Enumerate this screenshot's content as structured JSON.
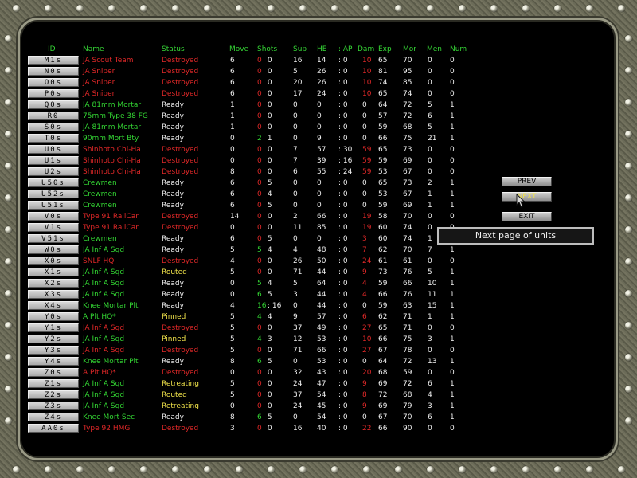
{
  "headers": {
    "id": "ID",
    "name": "Name",
    "status": "Status",
    "move": "Move",
    "shots": "Shots",
    "sup": "Sup",
    "he": "HE",
    "ap": ": AP",
    "dam": "Dam",
    "exp": "Exp",
    "mor": "Mor",
    "men": "Men",
    "num": "Num"
  },
  "colors": {
    "green": "#33d633",
    "red": "#e02828",
    "yellow": "#f0e24a"
  },
  "units": [
    {
      "id": "M1s",
      "name": "JA Scout Team",
      "status": "Destroyed",
      "move": "6",
      "shots_a": "0",
      "shots_b": ": 0",
      "sup": "16",
      "he": "14",
      "ap": ": 0",
      "dam": "10",
      "exp": "65",
      "mor": "70",
      "men": "0",
      "num": "0"
    },
    {
      "id": "N0s",
      "name": "JA Sniper",
      "status": "Destroyed",
      "move": "6",
      "shots_a": "0",
      "shots_b": ": 0",
      "sup": "5",
      "he": "26",
      "ap": ": 0",
      "dam": "10",
      "exp": "81",
      "mor": "95",
      "men": "0",
      "num": "0"
    },
    {
      "id": "O0s",
      "name": "JA Sniper",
      "status": "Destroyed",
      "move": "6",
      "shots_a": "0",
      "shots_b": ": 0",
      "sup": "20",
      "he": "26",
      "ap": ": 0",
      "dam": "10",
      "exp": "74",
      "mor": "85",
      "men": "0",
      "num": "0"
    },
    {
      "id": "P0s",
      "name": "JA Sniper",
      "status": "Destroyed",
      "move": "6",
      "shots_a": "0",
      "shots_b": ": 0",
      "sup": "17",
      "he": "24",
      "ap": ": 0",
      "dam": "10",
      "exp": "65",
      "mor": "74",
      "men": "0",
      "num": "0"
    },
    {
      "id": "Q0s",
      "name": "JA 81mm Mortar",
      "status": "Ready",
      "move": "1",
      "shots_a": "0",
      "shots_b": ": 0",
      "sup": "0",
      "he": "0",
      "ap": ": 0",
      "dam": "0",
      "exp": "64",
      "mor": "72",
      "men": "5",
      "num": "1"
    },
    {
      "id": "R0",
      "name": "75mm Type 38 FG",
      "status": "Ready",
      "move": "1",
      "shots_a": "0",
      "shots_b": ": 0",
      "sup": "0",
      "he": "0",
      "ap": ": 0",
      "dam": "0",
      "exp": "57",
      "mor": "72",
      "men": "6",
      "num": "1"
    },
    {
      "id": "S0s",
      "name": "JA 81mm Mortar",
      "status": "Ready",
      "move": "1",
      "shots_a": "0",
      "shots_b": ": 0",
      "sup": "0",
      "he": "0",
      "ap": ": 0",
      "dam": "0",
      "exp": "59",
      "mor": "68",
      "men": "5",
      "num": "1"
    },
    {
      "id": "T0s",
      "name": "90mm Mort Bty",
      "status": "Ready",
      "move": "0",
      "shots_a": "2",
      "shots_b": ": 1",
      "sup": "0",
      "he": "9",
      "ap": ": 0",
      "dam": "0",
      "exp": "66",
      "mor": "75",
      "men": "21",
      "num": "1"
    },
    {
      "id": "U0s",
      "name": "Shinhoto Chi-Ha",
      "status": "Destroyed",
      "move": "0",
      "shots_a": "0",
      "shots_b": ": 0",
      "sup": "7",
      "he": "57",
      "ap": ": 30",
      "dam": "59",
      "exp": "65",
      "mor": "73",
      "men": "0",
      "num": "0"
    },
    {
      "id": "U1s",
      "name": "Shinhoto Chi-Ha",
      "status": "Destroyed",
      "move": "0",
      "shots_a": "0",
      "shots_b": ": 0",
      "sup": "7",
      "he": "39",
      "ap": ": 16",
      "dam": "59",
      "exp": "59",
      "mor": "69",
      "men": "0",
      "num": "0"
    },
    {
      "id": "U2s",
      "name": "Shinhoto Chi-Ha",
      "status": "Destroyed",
      "move": "8",
      "shots_a": "0",
      "shots_b": ": 0",
      "sup": "6",
      "he": "55",
      "ap": ": 24",
      "dam": "59",
      "exp": "53",
      "mor": "67",
      "men": "0",
      "num": "0"
    },
    {
      "id": "U50s",
      "name": "Crewmen",
      "status": "Ready",
      "move": "6",
      "shots_a": "0",
      "shots_b": ": 5",
      "sup": "0",
      "he": "0",
      "ap": ": 0",
      "dam": "0",
      "exp": "65",
      "mor": "73",
      "men": "2",
      "num": "1"
    },
    {
      "id": "U52s",
      "name": "Crewmen",
      "status": "Ready",
      "move": "6",
      "shots_a": "0",
      "shots_b": ": 4",
      "sup": "0",
      "he": "0",
      "ap": ": 0",
      "dam": "0",
      "exp": "53",
      "mor": "67",
      "men": "1",
      "num": "1"
    },
    {
      "id": "U51s",
      "name": "Crewmen",
      "status": "Ready",
      "move": "6",
      "shots_a": "0",
      "shots_b": ": 5",
      "sup": "0",
      "he": "0",
      "ap": ": 0",
      "dam": "0",
      "exp": "59",
      "mor": "69",
      "men": "1",
      "num": "1"
    },
    {
      "id": "V0s",
      "name": "Type 91 RailCar",
      "status": "Destroyed",
      "move": "14",
      "shots_a": "0",
      "shots_b": ": 0",
      "sup": "2",
      "he": "66",
      "ap": ": 0",
      "dam": "19",
      "exp": "58",
      "mor": "70",
      "men": "0",
      "num": "0"
    },
    {
      "id": "V1s",
      "name": "Type 91 RailCar",
      "status": "Destroyed",
      "move": "0",
      "shots_a": "0",
      "shots_b": ": 0",
      "sup": "11",
      "he": "85",
      "ap": ": 0",
      "dam": "19",
      "exp": "60",
      "mor": "74",
      "men": "0",
      "num": "0"
    },
    {
      "id": "V51s",
      "name": "Crewmen",
      "status": "Ready",
      "move": "6",
      "shots_a": "0",
      "shots_b": ": 5",
      "sup": "0",
      "he": "0",
      "ap": ": 0",
      "dam": "3",
      "exp": "60",
      "mor": "74",
      "men": "1",
      "num": "1"
    },
    {
      "id": "W0s",
      "name": "JA Inf A Sqd",
      "status": "Ready",
      "move": "5",
      "shots_a": "5",
      "shots_b": ": 4",
      "sup": "4",
      "he": "48",
      "ap": ": 0",
      "dam": "7",
      "exp": "62",
      "mor": "70",
      "men": "7",
      "num": "1"
    },
    {
      "id": "X0s",
      "name": "SNLF HQ",
      "status": "Destroyed",
      "move": "4",
      "shots_a": "0",
      "shots_b": ": 0",
      "sup": "26",
      "he": "50",
      "ap": ": 0",
      "dam": "24",
      "exp": "61",
      "mor": "61",
      "men": "0",
      "num": "0"
    },
    {
      "id": "X1s",
      "name": "JA Inf A Sqd",
      "status": "Routed",
      "move": "5",
      "shots_a": "0",
      "shots_b": ": 0",
      "sup": "71",
      "he": "44",
      "ap": ": 0",
      "dam": "9",
      "exp": "73",
      "mor": "76",
      "men": "5",
      "num": "1"
    },
    {
      "id": "X2s",
      "name": "JA Inf A Sqd",
      "status": "Ready",
      "move": "0",
      "shots_a": "5",
      "shots_b": ": 4",
      "sup": "5",
      "he": "64",
      "ap": ": 0",
      "dam": "4",
      "exp": "59",
      "mor": "66",
      "men": "10",
      "num": "1"
    },
    {
      "id": "X3s",
      "name": "JA Inf A Sqd",
      "status": "Ready",
      "move": "0",
      "shots_a": "6",
      "shots_b": ": 5",
      "sup": "3",
      "he": "44",
      "ap": ": 0",
      "dam": "4",
      "exp": "66",
      "mor": "76",
      "men": "11",
      "num": "1"
    },
    {
      "id": "X4s",
      "name": "Knee Mortar Plt",
      "status": "Ready",
      "move": "4",
      "shots_a": "16",
      "shots_b": ": 16",
      "sup": "0",
      "he": "44",
      "ap": ": 0",
      "dam": "0",
      "exp": "59",
      "mor": "63",
      "men": "15",
      "num": "1"
    },
    {
      "id": "Y0s",
      "name": "A Plt HQ*",
      "status": "Pinned",
      "move": "5",
      "shots_a": "4",
      "shots_b": ": 4",
      "sup": "9",
      "he": "57",
      "ap": ": 0",
      "dam": "6",
      "exp": "62",
      "mor": "71",
      "men": "1",
      "num": "1"
    },
    {
      "id": "Y1s",
      "name": "JA Inf A Sqd",
      "status": "Destroyed",
      "move": "5",
      "shots_a": "0",
      "shots_b": ": 0",
      "sup": "37",
      "he": "49",
      "ap": ": 0",
      "dam": "27",
      "exp": "65",
      "mor": "71",
      "men": "0",
      "num": "0"
    },
    {
      "id": "Y2s",
      "name": "JA Inf A Sqd",
      "status": "Pinned",
      "move": "5",
      "shots_a": "4",
      "shots_b": ": 3",
      "sup": "12",
      "he": "53",
      "ap": ": 0",
      "dam": "10",
      "exp": "66",
      "mor": "75",
      "men": "3",
      "num": "1"
    },
    {
      "id": "Y3s",
      "name": "JA Inf A Sqd",
      "status": "Destroyed",
      "move": "5",
      "shots_a": "0",
      "shots_b": ": 0",
      "sup": "71",
      "he": "66",
      "ap": ": 0",
      "dam": "27",
      "exp": "67",
      "mor": "78",
      "men": "0",
      "num": "0"
    },
    {
      "id": "Y4s",
      "name": "Knee Mortar Plt",
      "status": "Ready",
      "move": "8",
      "shots_a": "6",
      "shots_b": ": 5",
      "sup": "0",
      "he": "53",
      "ap": ": 0",
      "dam": "0",
      "exp": "64",
      "mor": "72",
      "men": "13",
      "num": "1"
    },
    {
      "id": "Z0s",
      "name": "A Plt HQ*",
      "status": "Destroyed",
      "move": "0",
      "shots_a": "0",
      "shots_b": ": 0",
      "sup": "32",
      "he": "43",
      "ap": ": 0",
      "dam": "20",
      "exp": "68",
      "mor": "59",
      "men": "0",
      "num": "0"
    },
    {
      "id": "Z1s",
      "name": "JA Inf A Sqd",
      "status": "Retreating",
      "move": "5",
      "shots_a": "0",
      "shots_b": ": 0",
      "sup": "24",
      "he": "47",
      "ap": ": 0",
      "dam": "9",
      "exp": "69",
      "mor": "72",
      "men": "6",
      "num": "1"
    },
    {
      "id": "Z2s",
      "name": "JA Inf A Sqd",
      "status": "Routed",
      "move": "5",
      "shots_a": "0",
      "shots_b": ": 0",
      "sup": "37",
      "he": "54",
      "ap": ": 0",
      "dam": "8",
      "exp": "72",
      "mor": "68",
      "men": "4",
      "num": "1"
    },
    {
      "id": "Z3s",
      "name": "JA Inf A Sqd",
      "status": "Retreating",
      "move": "0",
      "shots_a": "0",
      "shots_b": ": 0",
      "sup": "24",
      "he": "45",
      "ap": ": 0",
      "dam": "9",
      "exp": "69",
      "mor": "79",
      "men": "3",
      "num": "1"
    },
    {
      "id": "Z4s",
      "name": "Knee Mort Sec",
      "status": "Ready",
      "move": "8",
      "shots_a": "6",
      "shots_b": ": 5",
      "sup": "0",
      "he": "54",
      "ap": ": 0",
      "dam": "0",
      "exp": "67",
      "mor": "70",
      "men": "6",
      "num": "1"
    },
    {
      "id": "AA0s",
      "name": "Type 92 HMG",
      "status": "Destroyed",
      "move": "3",
      "shots_a": "0",
      "shots_b": ": 0",
      "sup": "16",
      "he": "40",
      "ap": ": 0",
      "dam": "22",
      "exp": "66",
      "mor": "90",
      "men": "0",
      "num": "0"
    }
  ],
  "nav": {
    "prev_label": "PREV",
    "next_label": "NEXT",
    "exit_label": "EXIT"
  },
  "tooltip": {
    "text": "Next page of units"
  }
}
